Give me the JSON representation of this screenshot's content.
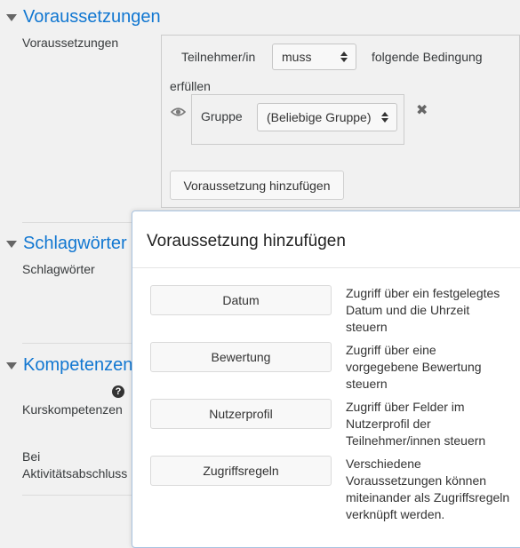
{
  "sections": {
    "restrictions": {
      "title": "Voraussetzungen",
      "field_label": "Voraussetzungen"
    },
    "tags": {
      "title": "Schlagwörter",
      "field_label": "Schlagwörter"
    },
    "competencies": {
      "title": "Kompetenzen",
      "course_competencies_label": "Kurskompetenzen",
      "activity_completion_label_line1": "Bei",
      "activity_completion_label_line2": "Aktivitätsabschluss"
    }
  },
  "restriction_box": {
    "participant_label": "Teilnehmer/in",
    "must_select_value": "muss",
    "condition_text_part1": "folgende Bedingung",
    "condition_text_part2": "erfüllen",
    "group_label": "Gruppe",
    "group_select_value": "(Beliebige Gruppe)",
    "delete_symbol": "✖",
    "add_button_label": "Voraussetzung hinzufügen"
  },
  "dialog": {
    "title": "Voraussetzung hinzufügen",
    "options": [
      {
        "label": "Datum",
        "description": "Zugriff über ein festgelegtes Datum und die Uhrzeit steuern"
      },
      {
        "label": "Bewertung",
        "description": "Zugriff über eine vorgegebene Bewertung steuern"
      },
      {
        "label": "Nutzerprofil",
        "description": "Zugriff über Felder im Nutzerprofil der Teilnehmer/innen steuern"
      },
      {
        "label": "Zugriffsregeln",
        "description": "Verschiedene Voraussetzungen können miteinander als Zugriffsregeln verknüpft werden."
      }
    ]
  },
  "help_icon_glyph": "?",
  "icons": {
    "eye": "eye-icon",
    "delete": "close-icon",
    "help": "question-circle-icon",
    "collapse": "caret-down-icon"
  },
  "colors": {
    "section_title": "#1177d1",
    "background": "#f1f1f1",
    "dialog_border": "#a9c3e0"
  }
}
